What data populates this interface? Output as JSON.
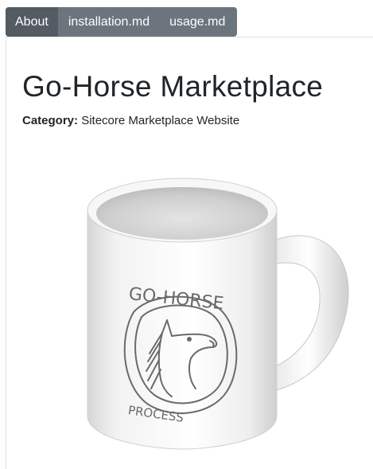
{
  "tabs": [
    {
      "label": "About",
      "active": true
    },
    {
      "label": "installation.md",
      "active": false
    },
    {
      "label": "usage.md",
      "active": false
    }
  ],
  "page": {
    "title": "Go-Horse Marketplace",
    "category_label": "Category:",
    "category_value": "Sitecore Marketplace Website"
  },
  "image": {
    "line1": "GO-HORSE",
    "line2": "PROCESS"
  },
  "colors": {
    "tab_bg": "#6c757d",
    "tab_active_bg": "#545b62",
    "text": "#212529",
    "border": "#dee2e6"
  }
}
